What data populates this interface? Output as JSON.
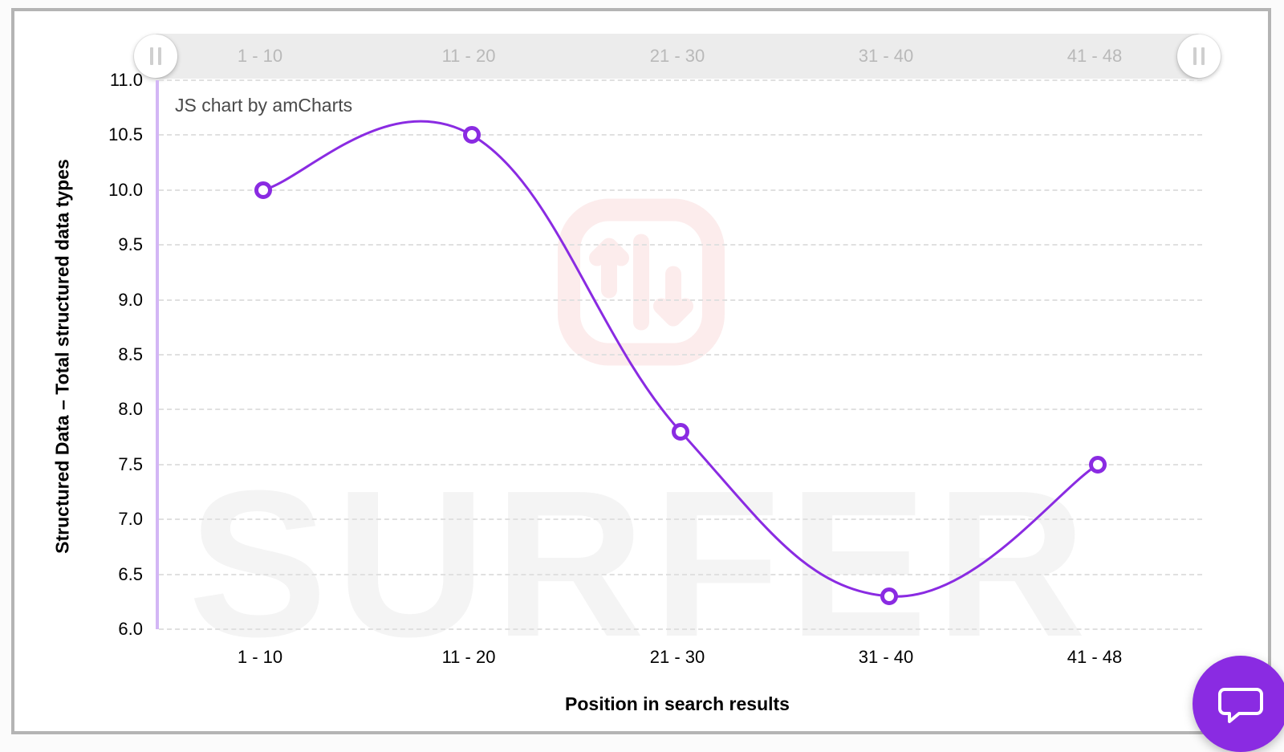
{
  "chart_data": {
    "type": "line",
    "title": "",
    "xlabel": "Position in search results",
    "ylabel": "Structured Data – Total structured data types",
    "ylim": [
      6.0,
      11.0
    ],
    "y_ticks": [
      6.0,
      6.5,
      7.0,
      7.5,
      8.0,
      8.5,
      9.0,
      9.5,
      10.0,
      10.5,
      11.0
    ],
    "categories": [
      "1 - 10",
      "11 - 20",
      "21 - 30",
      "31 - 40",
      "41 - 48"
    ],
    "values": [
      10.0,
      10.5,
      7.8,
      6.3,
      7.5
    ],
    "series_color": "#8a2be2",
    "credit": "JS chart by amCharts",
    "watermark": "SURFER",
    "scrollbar_labels": [
      "1 - 10",
      "11 - 20",
      "21 - 30",
      "31 - 40",
      "41 - 48"
    ]
  },
  "y_tick_labels": [
    "6.0",
    "6.5",
    "7.0",
    "7.5",
    "8.0",
    "8.5",
    "9.0",
    "9.5",
    "10.0",
    "10.5",
    "11.0"
  ]
}
